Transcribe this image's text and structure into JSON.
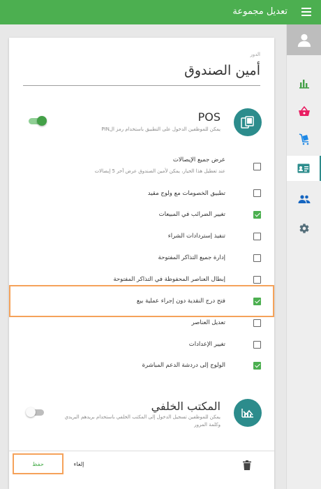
{
  "header": {
    "title": "تعديل مجموعة",
    "menu_icon": "menu-icon"
  },
  "sidebar": {
    "items": [
      {
        "name": "avatar",
        "icon": "person-icon"
      },
      {
        "name": "reports",
        "icon": "bar-chart-icon"
      },
      {
        "name": "items",
        "icon": "basket-icon"
      },
      {
        "name": "inventory",
        "icon": "cart-icon"
      },
      {
        "name": "employees",
        "icon": "id-card-icon",
        "active": true
      },
      {
        "name": "customers",
        "icon": "people-icon"
      },
      {
        "name": "settings",
        "icon": "gear-icon"
      }
    ]
  },
  "role": {
    "label": "الدور",
    "name": "أمين الصندوق"
  },
  "pos": {
    "title": "POS",
    "description": "يمكن للموظفين الدخول على التطبيق باستخدام رمز الPIN",
    "enabled": true,
    "icon": "pos-device-icon",
    "permissions": [
      {
        "label": "عرض جميع الإيصالات",
        "sub": "عند تعطيل هذا الخيار، يمكن لأمين الصندوق عرض آخر 5 إيصالات",
        "checked": false
      },
      {
        "label": "تطبيق الخصومات مع ولوج مقيد",
        "checked": false
      },
      {
        "label": "تغيير الضرائب في المبيعات",
        "checked": true
      },
      {
        "label": "تنفيذ إستردادات الشراء",
        "checked": false
      },
      {
        "label": "إدارة جميع التذاكر المفتوحة",
        "checked": false
      },
      {
        "label": "إبطال العناصر المحفوظة في التذاكر المفتوحة",
        "checked": false
      },
      {
        "label": "فتح درج النقدية دون إجراء عملية بيع",
        "checked": true
      },
      {
        "label": "تعديل العناصر",
        "checked": false
      },
      {
        "label": "تغيير الإعدادات",
        "checked": false
      },
      {
        "label": "الولوج إلى دردشة الدعم المباشرة",
        "checked": true
      }
    ]
  },
  "backoffice": {
    "title": "المكتب الخلفي",
    "description_line1": "يمكن للموظفين تسجيل الدخول إلى المكتب الخلفي باستخدام بريدهم البريدي",
    "description_line2": "وكلمة المرور",
    "enabled": false,
    "icon": "dashboard-icon"
  },
  "footer": {
    "save_label": "حفظ",
    "cancel_label": "إلغاء",
    "delete_icon": "trash-icon"
  },
  "colors": {
    "primary": "#4caf50",
    "accent": "#2c8c8c",
    "highlight": "#f5a25a"
  }
}
